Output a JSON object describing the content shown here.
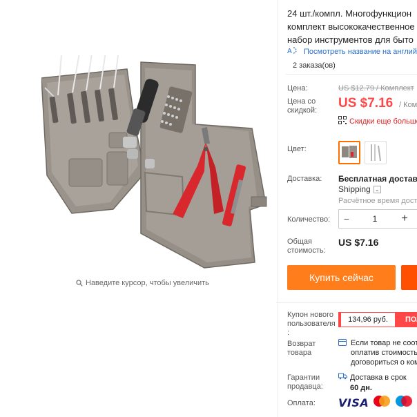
{
  "product": {
    "title_lines": [
      "24 шт./компл. Многофункцион",
      "комплект высококачественное",
      "набор инструментов для быто"
    ],
    "translate_link": "Посмотреть название на англий",
    "orders": "2 заказа(ов)"
  },
  "image": {
    "zoom_hint": "Наведите курсор, чтобы увеличить",
    "case_color": "#8e8780",
    "handle_color": "#d8282e"
  },
  "price": {
    "label": "Цена:",
    "old": "US $12.79 / Комплект",
    "discount_label_1": "Цена со",
    "discount_label_2": "скидкой:",
    "discount": "US $7.16",
    "discount_unit": "/ Комп",
    "app_promo": "Скидки еще больше"
  },
  "options": {
    "color_label": "Цвет:",
    "swatches": [
      {
        "name": "tool-case",
        "selected": true
      },
      {
        "name": "tool-set-silver",
        "selected": false
      }
    ]
  },
  "shipping": {
    "label": "Доставка:",
    "main": "Бесплатная доставка",
    "method": "Shipping",
    "estimate": "Расчётное время доставки"
  },
  "quantity": {
    "label": "Количество:",
    "value": "1",
    "minus": "−",
    "plus": "+"
  },
  "total": {
    "label_1": "Общая",
    "label_2": "стоимость:",
    "value": "US $7.16"
  },
  "actions": {
    "buy_now": "Купить сейчас"
  },
  "coupon": {
    "label_1": "Купон нового",
    "label_2": "пользователя",
    "label_3": ":",
    "amount": "134,96 руб.",
    "button": "ПОЛ"
  },
  "returns": {
    "label_1": "Возврат",
    "label_2": "товара",
    "text_1": "Если товар не соотв",
    "text_2": "оплатив стоимость",
    "text_3": "договориться о ком"
  },
  "guarantee": {
    "label_1": "Гарантии",
    "label_2": "продавца:",
    "text_1": "Доставка в срок",
    "text_2": "60 дн."
  },
  "payment": {
    "label": "Оплата:",
    "visa": "VISA"
  }
}
